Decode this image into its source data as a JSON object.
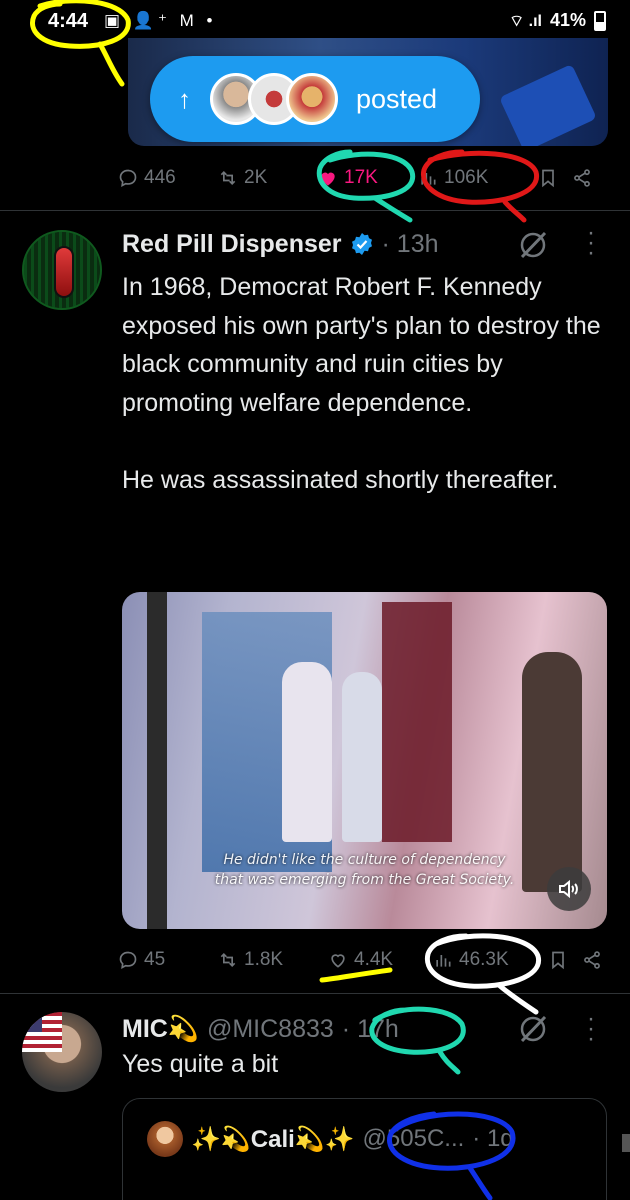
{
  "status_bar": {
    "time": "4:44",
    "left_icons": "▣ 👤⁺ M •",
    "battery": "41%",
    "signal": "⌔ .ıl"
  },
  "posted_banner": {
    "label": "posted",
    "arrow": "↑"
  },
  "top_tweet_actions": {
    "replies": "446",
    "reposts": "2K",
    "likes": "17K",
    "views": "106K"
  },
  "tweet": {
    "author_name": "Red Pill Dispenser",
    "time": "· 13h",
    "text": "In 1968, Democrat Robert F. Kennedy exposed his own party's plan to destroy the black community and ruin cities by promoting welfare dependence.\n\nHe was assassinated shortly thereafter.",
    "media_subtitle_1": "He didn't like the culture of dependency",
    "media_subtitle_2": "that was emerging from the Great Society.",
    "actions": {
      "replies": "45",
      "reposts": "1.8K",
      "likes": "4.4K",
      "views": "46.3K"
    }
  },
  "reply": {
    "author_name": "MIC",
    "handle": "@MIC8833",
    "time": "· 17h",
    "text": "Yes quite a bit",
    "quote": {
      "author_name": "Cali",
      "handle": "@505C...",
      "time": "· 1d"
    }
  },
  "colors": {
    "background": "#000000",
    "text": "#e7e9ea",
    "muted": "#71767b",
    "accent_blue": "#1d9bf0",
    "like_pink": "#f91880",
    "annot_yellow": "#ffff00",
    "annot_teal": "#20d8b0",
    "annot_red": "#e01818",
    "annot_white": "#ffffff",
    "annot_blue": "#1030e8"
  }
}
